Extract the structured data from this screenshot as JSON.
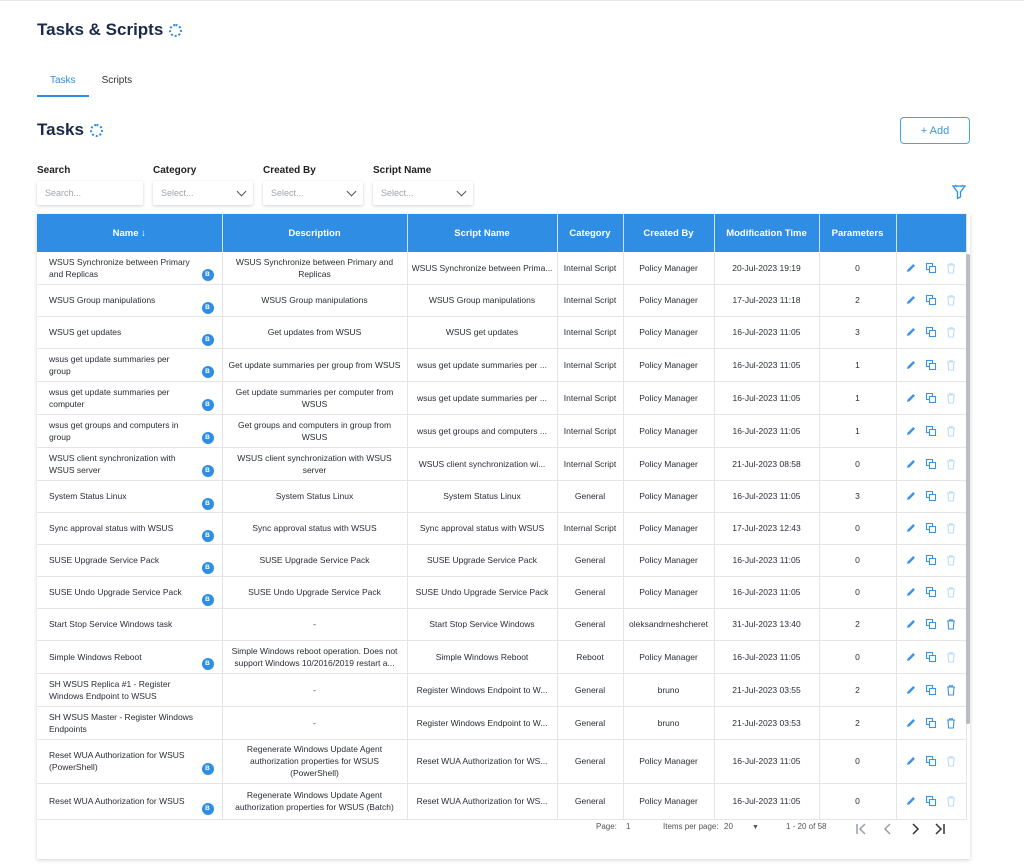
{
  "header": {
    "title": "Tasks & Scripts"
  },
  "tabs": [
    {
      "label": "Tasks",
      "active": true
    },
    {
      "label": "Scripts",
      "active": false
    }
  ],
  "section": {
    "title": "Tasks",
    "add_label": "+ Add"
  },
  "filters": {
    "search": {
      "label": "Search",
      "placeholder": "Search..."
    },
    "category": {
      "label": "Category",
      "placeholder": "Select..."
    },
    "created_by": {
      "label": "Created By",
      "placeholder": "Select..."
    },
    "script_name": {
      "label": "Script Name",
      "placeholder": "Select..."
    }
  },
  "table": {
    "columns": [
      "Name ↓",
      "Description",
      "Script Name",
      "Category",
      "Created By",
      "Modification Time",
      "Parameters",
      ""
    ],
    "rows": [
      {
        "name": "WSUS Synchronize between Primary and Replicas",
        "badge": "B",
        "description": "WSUS Synchronize between Primary and Replicas",
        "script": "WSUS Synchronize between Prima...",
        "category": "Internal Script",
        "created_by": "Policy Manager",
        "modified": "20-Jul-2023 19:19",
        "params": "0",
        "delete_enabled": false
      },
      {
        "name": "WSUS Group manipulations",
        "badge": "B",
        "description": "WSUS Group manipulations",
        "script": "WSUS Group manipulations",
        "category": "Internal Script",
        "created_by": "Policy Manager",
        "modified": "17-Jul-2023 11:18",
        "params": "2",
        "delete_enabled": false
      },
      {
        "name": "WSUS get updates",
        "badge": "B",
        "description": "Get updates from WSUS",
        "script": "WSUS get updates",
        "category": "Internal Script",
        "created_by": "Policy Manager",
        "modified": "16-Jul-2023 11:05",
        "params": "3",
        "delete_enabled": false
      },
      {
        "name": "wsus get update summaries per group",
        "badge": "B",
        "description": "Get update summaries per group from WSUS",
        "script": "wsus get update summaries per ...",
        "category": "Internal Script",
        "created_by": "Policy Manager",
        "modified": "16-Jul-2023 11:05",
        "params": "1",
        "delete_enabled": false
      },
      {
        "name": "wsus get update summaries per computer",
        "badge": "B",
        "description": "Get update summaries per computer from WSUS",
        "script": "wsus get update summaries per ...",
        "category": "Internal Script",
        "created_by": "Policy Manager",
        "modified": "16-Jul-2023 11:05",
        "params": "1",
        "delete_enabled": false
      },
      {
        "name": "wsus get groups and computers in group",
        "badge": "B",
        "description": "Get groups and computers in group from WSUS",
        "script": "wsus get groups and computers ...",
        "category": "Internal Script",
        "created_by": "Policy Manager",
        "modified": "16-Jul-2023 11:05",
        "params": "1",
        "delete_enabled": false
      },
      {
        "name": "WSUS client synchronization with WSUS server",
        "badge": "B",
        "description": "WSUS client synchronization with WSUS server",
        "script": "WSUS client synchronization wi...",
        "category": "Internal Script",
        "created_by": "Policy Manager",
        "modified": "21-Jul-2023 08:58",
        "params": "0",
        "delete_enabled": false
      },
      {
        "name": "System Status Linux",
        "badge": "B",
        "description": "System Status Linux",
        "script": "System Status Linux",
        "category": "General",
        "created_by": "Policy Manager",
        "modified": "16-Jul-2023 11:05",
        "params": "3",
        "delete_enabled": false
      },
      {
        "name": "Sync approval status with WSUS",
        "badge": "B",
        "description": "Sync approval status with WSUS",
        "script": "Sync approval status with WSUS",
        "category": "Internal Script",
        "created_by": "Policy Manager",
        "modified": "17-Jul-2023 12:43",
        "params": "0",
        "delete_enabled": false
      },
      {
        "name": "SUSE Upgrade Service Pack",
        "badge": "B",
        "description": "SUSE Upgrade Service Pack",
        "script": "SUSE Upgrade Service Pack",
        "category": "General",
        "created_by": "Policy Manager",
        "modified": "16-Jul-2023 11:05",
        "params": "0",
        "delete_enabled": false
      },
      {
        "name": "SUSE Undo Upgrade Service Pack",
        "badge": "B",
        "description": "SUSE Undo Upgrade Service Pack",
        "script": "SUSE Undo Upgrade Service Pack",
        "category": "General",
        "created_by": "Policy Manager",
        "modified": "16-Jul-2023 11:05",
        "params": "0",
        "delete_enabled": false
      },
      {
        "name": "Start Stop Service Windows task",
        "badge": "",
        "description": "-",
        "script": "Start Stop Service Windows",
        "category": "General",
        "created_by": "oleksandrneshcheret",
        "modified": "31-Jul-2023 13:40",
        "params": "2",
        "delete_enabled": true
      },
      {
        "name": "Simple Windows Reboot",
        "badge": "B",
        "description": "Simple Windows reboot operation. Does not support Windows 10/2016/2019 restart a...",
        "script": "Simple Windows Reboot",
        "category": "Reboot",
        "created_by": "Policy Manager",
        "modified": "16-Jul-2023 11:05",
        "params": "0",
        "delete_enabled": false
      },
      {
        "name": "SH WSUS Replica #1 - Register Windows Endpoint to WSUS",
        "badge": "",
        "description": "-",
        "script": "Register Windows Endpoint to W...",
        "category": "General",
        "created_by": "bruno",
        "modified": "21-Jul-2023 03:55",
        "params": "2",
        "delete_enabled": true
      },
      {
        "name": "SH WSUS Master - Register Windows Endpoints",
        "badge": "",
        "description": "-",
        "script": "Register Windows Endpoint to W...",
        "category": "General",
        "created_by": "bruno",
        "modified": "21-Jul-2023 03:53",
        "params": "2",
        "delete_enabled": true
      },
      {
        "name": "Reset WUA Authorization for WSUS (PowerShell)",
        "badge": "B",
        "description": "Regenerate Windows Update Agent authorization properties for WSUS (PowerShell)",
        "script": "Reset WUA Authorization for WS...",
        "category": "General",
        "created_by": "Policy Manager",
        "modified": "16-Jul-2023 11:05",
        "params": "0",
        "delete_enabled": false
      },
      {
        "name": "Reset WUA Authorization for WSUS",
        "badge": "B",
        "description": "Regenerate Windows Update Agent authorization properties for WSUS (Batch)",
        "script": "Reset WUA Authorization for WS...",
        "category": "General",
        "created_by": "Policy Manager",
        "modified": "16-Jul-2023 11:05",
        "params": "0",
        "delete_enabled": false
      }
    ]
  },
  "pagination": {
    "page_label": "Page:",
    "page": "1",
    "items_label": "Items per page:",
    "items": "20",
    "range": "1 - 20 of 58"
  },
  "colors": {
    "accent": "#2f8de4",
    "title": "#1b2a4a"
  }
}
